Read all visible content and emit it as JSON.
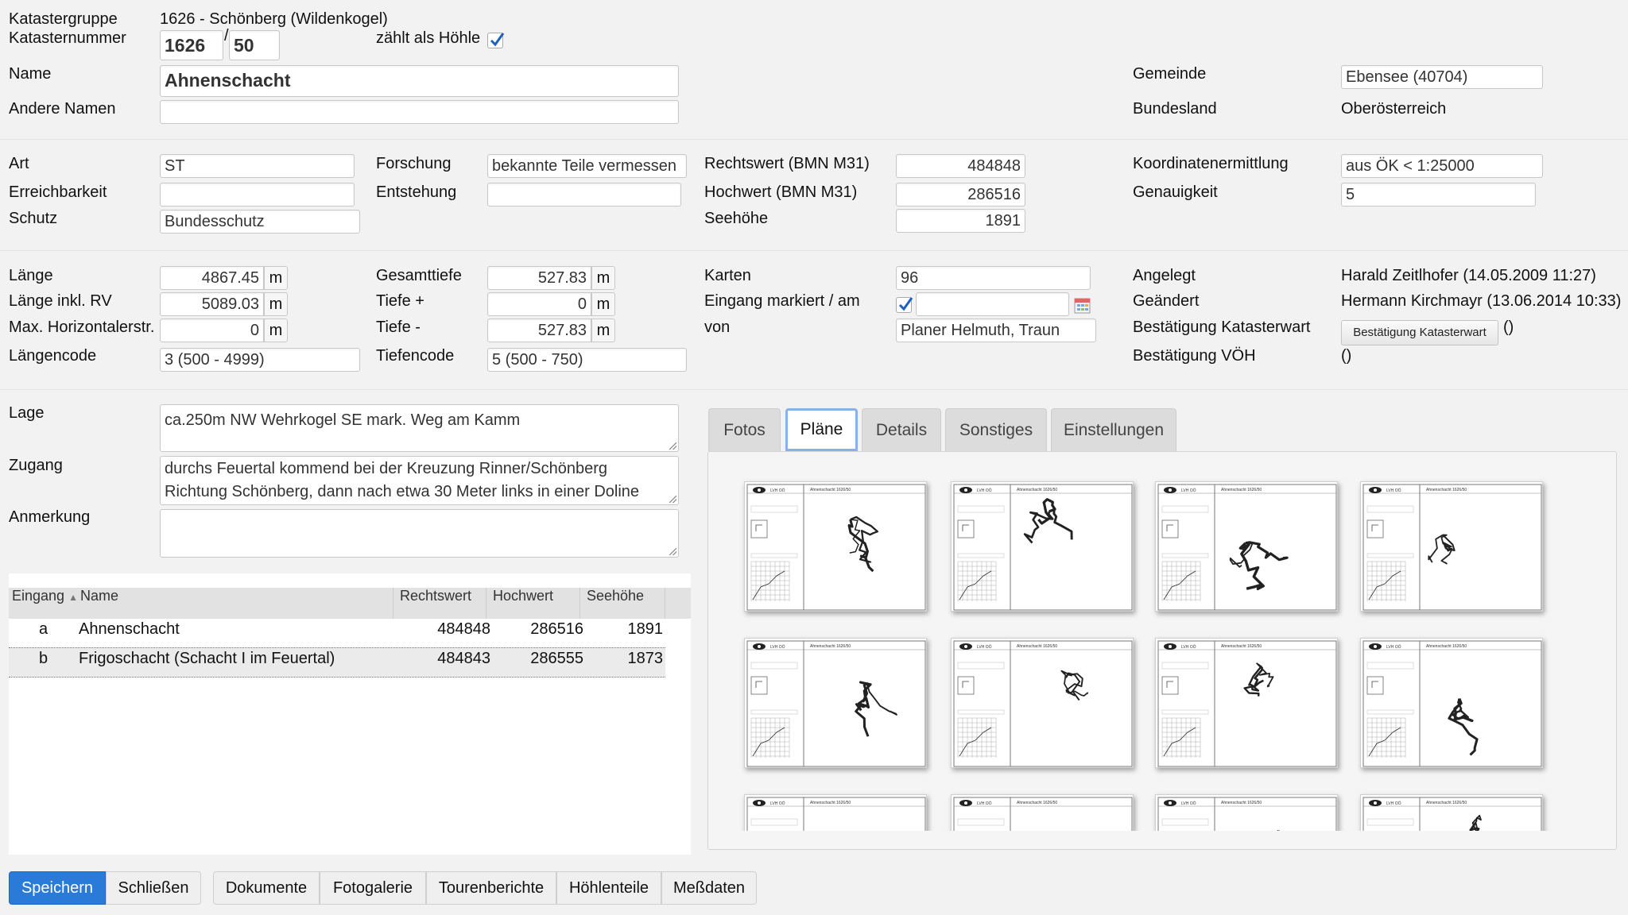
{
  "header": {
    "katastergruppe_label": "Katastergruppe",
    "katastergruppe_value": "1626 - Schönberg (Wildenkogel)",
    "katasternummer_label": "Katasternummer",
    "katasternummer_1": "1626",
    "slash": "/",
    "katasternummer_2": "50",
    "zaehlt_label": "zählt als Höhle",
    "zaehlt_checked": true,
    "name_label": "Name",
    "name_value": "Ahnenschacht",
    "andere_namen_label": "Andere Namen",
    "andere_namen_value": "",
    "gemeinde_label": "Gemeinde",
    "gemeinde_value": "Ebensee (40704)",
    "bundesland_label": "Bundesland",
    "bundesland_value": "Oberösterreich"
  },
  "classification": {
    "art_label": "Art",
    "art_value": "ST",
    "erreichbarkeit_label": "Erreichbarkeit",
    "erreichbarkeit_value": "",
    "schutz_label": "Schutz",
    "schutz_value": "Bundesschutz",
    "forschung_label": "Forschung",
    "forschung_value": "bekannte Teile vermessen",
    "entstehung_label": "Entstehung",
    "entstehung_value": "",
    "rechtswert_label": "Rechtswert (BMN M31)",
    "rechtswert_value": "484848",
    "hochwert_label": "Hochwert (BMN M31)",
    "hochwert_value": "286516",
    "seehoehe_label": "Seehöhe",
    "seehoehe_value": "1891",
    "koord_label": "Koordinatenermittlung",
    "koord_value": "aus ÖK < 1:25000",
    "genauigkeit_label": "Genauigkeit",
    "genauigkeit_value": "5"
  },
  "measurements": {
    "laenge_label": "Länge",
    "laenge_value": "4867.45",
    "laenge_rv_label": "Länge inkl. RV",
    "laenge_rv_value": "5089.03",
    "max_horiz_label": "Max. Horizontalerstr.",
    "max_horiz_value": "0",
    "laengencode_label": "Längencode",
    "laengencode_value": "3 (500 - 4999)",
    "unit_m": "m",
    "gesamttiefe_label": "Gesamttiefe",
    "gesamttiefe_value": "527.83",
    "tiefe_plus_label": "Tiefe +",
    "tiefe_plus_value": "0",
    "tiefe_minus_label": "Tiefe -",
    "tiefe_minus_value": "527.83",
    "tiefencode_label": "Tiefencode",
    "tiefencode_value": "5 (500 - 750)",
    "karten_label": "Karten",
    "karten_value": "96",
    "eingang_markiert_label": "Eingang markiert / am",
    "eingang_markiert_checked": true,
    "eingang_markiert_date": "",
    "von_label": "von",
    "von_value": "Planer Helmuth, Traun",
    "angelegt_label": "Angelegt",
    "angelegt_value": "Harald Zeitlhofer (14.05.2009 11:27)",
    "geaendert_label": "Geändert",
    "geaendert_value": "Hermann Kirchmayr (13.06.2014 10:33)",
    "bestaetigung_kataster_label": "Bestätigung Katasterwart",
    "bestaetigung_kataster_button": "Bestätigung Katasterwart",
    "bestaetigung_kataster_value": "()",
    "bestaetigung_voeh_label": "Bestätigung VÖH",
    "bestaetigung_voeh_value": "()"
  },
  "description": {
    "lage_label": "Lage",
    "lage_value": "ca.250m NW Wehrkogel SE mark. Weg am Kamm",
    "zugang_label": "Zugang",
    "zugang_value": "durchs Feuertal kommend bei der Kreuzung Rinner/Schönberg Richtung Schönberg, dann nach etwa 30 Meter links in einer Doline",
    "anmerkung_label": "Anmerkung",
    "anmerkung_value": ""
  },
  "entrances": {
    "columns": [
      "Eingang",
      "Name",
      "Rechtswert",
      "Hochwert",
      "Seehöhe"
    ],
    "rows": [
      {
        "eingang": "a",
        "name": "Ahnenschacht",
        "rechtswert": "484848",
        "hochwert": "286516",
        "seehoehe": "1891"
      },
      {
        "eingang": "b",
        "name": "Frigoschacht (Schacht I im Feuertal)",
        "rechtswert": "484843",
        "hochwert": "286555",
        "seehoehe": "1873"
      }
    ]
  },
  "tabs": [
    "Fotos",
    "Pläne",
    "Details",
    "Sonstiges",
    "Einstellungen"
  ],
  "active_tab": "Pläne",
  "plans": {
    "thumb_header_left": "LVH OÖ",
    "thumb_header_mid": "Ahnenschacht 1626/50"
  },
  "buttons": {
    "speichern": "Speichern",
    "schliessen": "Schließen",
    "dokumente": "Dokumente",
    "fotogalerie": "Fotogalerie",
    "tourenberichte": "Tourenberichte",
    "hoehlenteile": "Höhlenteile",
    "messdaten": "Meßdaten"
  },
  "colors": {
    "primary": "#2a7ad8",
    "active_tab_border": "#8ab0e8"
  }
}
